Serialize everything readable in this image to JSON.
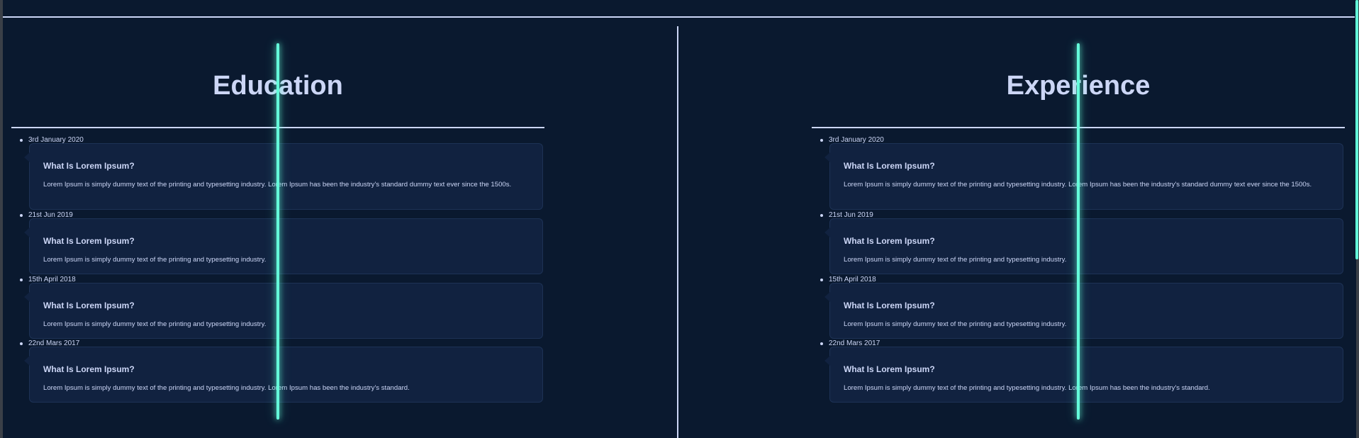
{
  "sections": [
    {
      "title": "Education",
      "entries": [
        {
          "date": "3rd January 2020",
          "heading": "What Is Lorem Ipsum?",
          "text": "Lorem Ipsum is simply dummy text of the printing and typesetting industry. Lorem Ipsum has been the industry's standard dummy text ever since the 1500s."
        },
        {
          "date": "21st Jun 2019",
          "heading": "What Is Lorem Ipsum?",
          "text": "Lorem Ipsum is simply dummy text of the printing and typesetting industry."
        },
        {
          "date": "15th April 2018",
          "heading": "What Is Lorem Ipsum?",
          "text": "Lorem Ipsum is simply dummy text of the printing and typesetting industry."
        },
        {
          "date": "22nd Mars 2017",
          "heading": "What Is Lorem Ipsum?",
          "text": "Lorem Ipsum is simply dummy text of the printing and typesetting industry. Lorem Ipsum has been the industry's standard."
        }
      ]
    },
    {
      "title": "Experience",
      "entries": [
        {
          "date": "3rd January 2020",
          "heading": "What Is Lorem Ipsum?",
          "text": "Lorem Ipsum is simply dummy text of the printing and typesetting industry. Lorem Ipsum has been the industry's standard dummy text ever since the 1500s."
        },
        {
          "date": "21st Jun 2019",
          "heading": "What Is Lorem Ipsum?",
          "text": "Lorem Ipsum is simply dummy text of the printing and typesetting industry."
        },
        {
          "date": "15th April 2018",
          "heading": "What Is Lorem Ipsum?",
          "text": "Lorem Ipsum is simply dummy text of the printing and typesetting industry."
        },
        {
          "date": "22nd Mars 2017",
          "heading": "What Is Lorem Ipsum?",
          "text": "Lorem Ipsum is simply dummy text of the printing and typesetting industry. Lorem Ipsum has been the industry's standard."
        }
      ]
    }
  ],
  "colors": {
    "background": "#0a192f",
    "card": "#112240",
    "accent": "#64ffda",
    "text": "#ccd6f6"
  }
}
